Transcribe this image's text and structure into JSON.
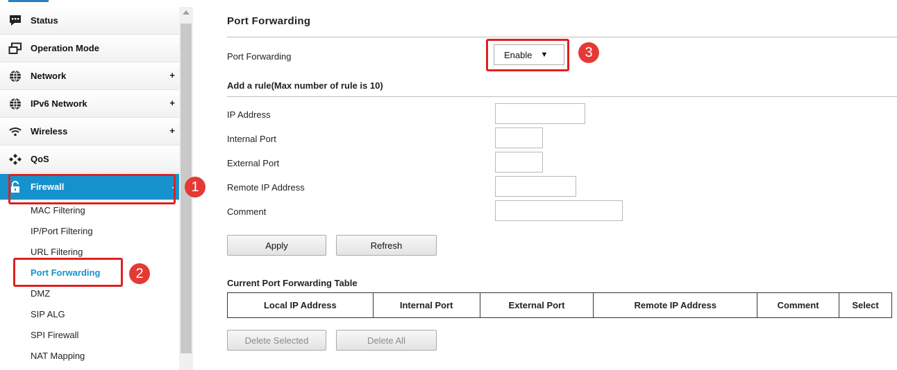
{
  "sidebar": {
    "items": [
      {
        "label": "Status",
        "icon": "chat-bubble-icon",
        "expandable": false
      },
      {
        "label": "Operation Mode",
        "icon": "window-icon",
        "expandable": false
      },
      {
        "label": "Network",
        "icon": "globe-icon",
        "expandable": true
      },
      {
        "label": "IPv6 Network",
        "icon": "globe-icon",
        "expandable": true
      },
      {
        "label": "Wireless",
        "icon": "wifi-icon",
        "expandable": true
      },
      {
        "label": "QoS",
        "icon": "qos-icon",
        "expandable": false
      },
      {
        "label": "Firewall",
        "icon": "lock-icon",
        "expandable": true
      }
    ],
    "expand_symbol": "+",
    "firewall_submenu": [
      "MAC Filtering",
      "IP/Port Filtering",
      "URL Filtering",
      "Port Forwarding",
      "DMZ",
      "SIP ALG",
      "SPI Firewall",
      "NAT Mapping"
    ],
    "active_item": "Firewall",
    "active_subitem": "Port Forwarding"
  },
  "annotations": [
    "1",
    "2",
    "3"
  ],
  "main": {
    "title": "Port Forwarding",
    "port_forwarding_label": "Port Forwarding",
    "port_forwarding_value": "Enable",
    "add_rule_title": "Add a rule(Max number of rule is 10)",
    "fields": {
      "ip_address": "IP Address",
      "internal_port": "Internal Port",
      "external_port": "External Port",
      "remote_ip": "Remote IP Address",
      "comment": "Comment"
    },
    "apply_label": "Apply",
    "refresh_label": "Refresh",
    "table_title": "Current Port Forwarding Table",
    "table_headers": [
      "Local IP Address",
      "Internal Port",
      "External Port",
      "Remote IP Address",
      "Comment",
      "Select"
    ],
    "delete_selected_label": "Delete Selected",
    "delete_all_label": "Delete All"
  },
  "colors": {
    "accent": "#1592cc",
    "annotation": "#e02020"
  }
}
